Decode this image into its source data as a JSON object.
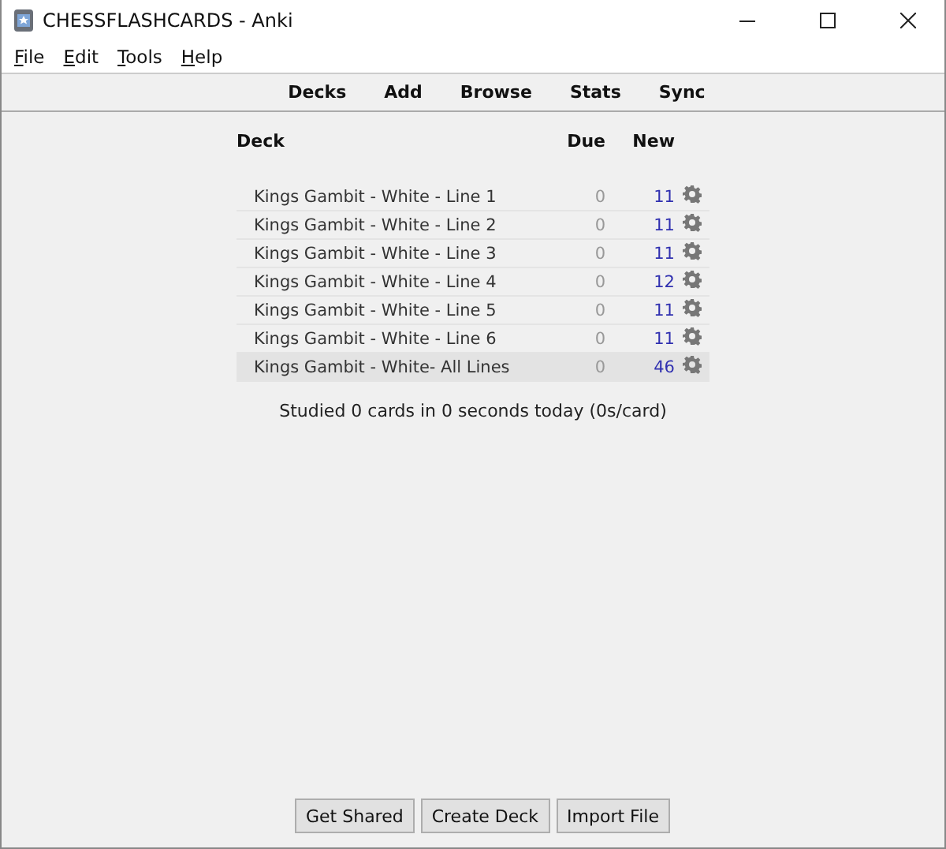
{
  "window": {
    "title": "CHESSFLASHCARDS - Anki"
  },
  "menu": [
    "File",
    "Edit",
    "Tools",
    "Help"
  ],
  "toolbar": [
    "Decks",
    "Add",
    "Browse",
    "Stats",
    "Sync"
  ],
  "deck_table": {
    "columns": [
      "Deck",
      "Due",
      "New"
    ],
    "rows": [
      {
        "deck": "Kings Gambit - White - Line 1",
        "due": "0",
        "new": "11",
        "selected": false
      },
      {
        "deck": "Kings Gambit - White - Line 2",
        "due": "0",
        "new": "11",
        "selected": false
      },
      {
        "deck": "Kings Gambit - White - Line 3",
        "due": "0",
        "new": "11",
        "selected": false
      },
      {
        "deck": "Kings Gambit - White - Line 4",
        "due": "0",
        "new": "12",
        "selected": false
      },
      {
        "deck": "Kings Gambit - White - Line 5",
        "due": "0",
        "new": "11",
        "selected": false
      },
      {
        "deck": "Kings Gambit - White - Line 6",
        "due": "0",
        "new": "11",
        "selected": false
      },
      {
        "deck": "Kings Gambit - White- All Lines",
        "due": "0",
        "new": "46",
        "selected": true
      }
    ]
  },
  "summary": "Studied 0 cards in 0 seconds today (0s/card)",
  "buttons": [
    "Get Shared",
    "Create Deck",
    "Import File"
  ]
}
